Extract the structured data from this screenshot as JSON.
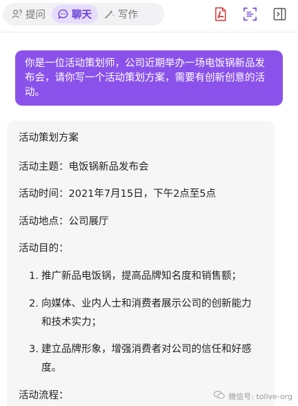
{
  "tabs": [
    {
      "label": "提问",
      "icon": "question-icon",
      "active": false
    },
    {
      "label": "聊天",
      "icon": "chat-bubble-icon",
      "active": true
    },
    {
      "label": "写作",
      "icon": "magic-wand-icon",
      "active": false
    }
  ],
  "toolbar_icons": [
    "pdf-icon",
    "screenshot-icon",
    "sidebar-toggle-icon"
  ],
  "colors": {
    "accent": "#8a52ea",
    "pdf_red": "#d93b3b",
    "tab_active_bg": "#e6dcfb"
  },
  "user_message": "你是一位活动策划师，公司近期举办一场电饭锅新品发布会，请你写一个活动策划方案，需要有创新创意的活动。",
  "reply": {
    "title": "活动策划方案",
    "theme": "活动主题：电饭锅新品发布会",
    "time": "活动时间：2021年7月15日，下午2点至5点",
    "location": "活动地点：公司展厅",
    "purpose_heading": "活动目的：",
    "purposes": [
      {
        "num": "1.",
        "text": "推广新品电饭锅，提高品牌知名度和销售额；"
      },
      {
        "num": "2.",
        "text": "向媒体、业内人士和消费者展示公司的创新能力和技术实力；"
      },
      {
        "num": "3.",
        "text": "建立品牌形象，增强消费者对公司的信任和好感度。"
      }
    ],
    "process_heading": "活动流程："
  },
  "watermark": "微信号: tolive-org"
}
